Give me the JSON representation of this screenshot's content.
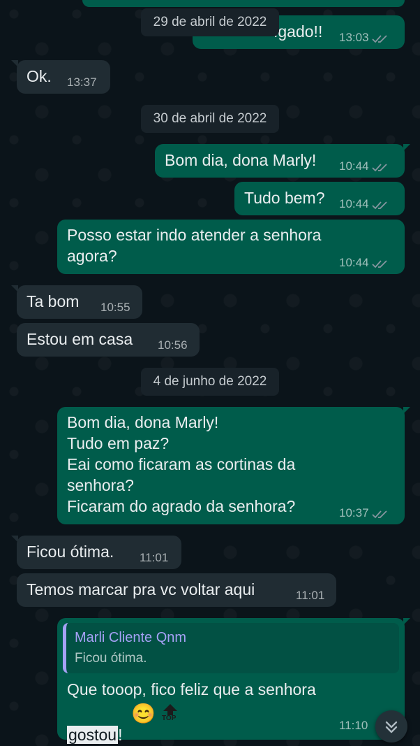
{
  "chat": {
    "messages": [
      {
        "text": "ígado!!",
        "time": "13:03"
      },
      {
        "text": "Ok.",
        "time": "13:37"
      },
      {
        "text": "Bom dia, dona Marly!",
        "time": "10:44"
      },
      {
        "text": "Tudo bem?",
        "time": "10:44"
      },
      {
        "text": "Posso estar indo atender a senhora\nagora?",
        "time": "10:44"
      },
      {
        "text": "Ta bom",
        "time": "10:55"
      },
      {
        "text": "Estou em casa",
        "time": "10:56"
      },
      {
        "text": "Bom dia, dona Marly!\nTudo em paz?\nEai como ficaram as cortinas da\nsenhora?\nFicaram do agrado da senhora?",
        "time": "10:37"
      },
      {
        "text": "Ficou ótima.",
        "time": "11:01"
      },
      {
        "text": "Temos marcar pra vc voltar aqui",
        "time": "11:01"
      },
      {
        "text_line1": "Que tooop, fico feliz que a senhora",
        "text_highlight": "gostou",
        "text_after": "!",
        "emoji": "😊",
        "top_label": "TOP",
        "time": "11:10"
      }
    ],
    "dates": [
      "29 de abril de 2022",
      "30 de abril de 2022",
      "4 de junho de 2022"
    ],
    "reply_quote": {
      "author": "Marli Cliente Qnm",
      "text": "Ficou ótima."
    }
  },
  "icons": {
    "read_receipt": "double-check-icon",
    "scroll_down": "chevron-double-down-icon",
    "top_arrow": "arrow-up-icon"
  },
  "colors": {
    "outgoing": "#005c4b",
    "incoming": "#202c33",
    "background": "#0b141a",
    "quote_author": "#a5a1f5",
    "read_ticks": "#8696a0"
  }
}
